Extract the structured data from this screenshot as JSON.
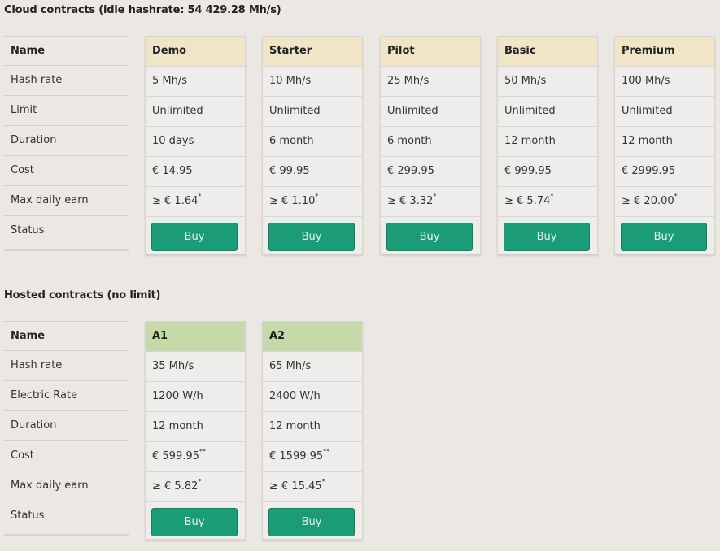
{
  "cloud": {
    "title": "Cloud contracts (idle hashrate: 54 429.28 Mh/s)",
    "labels": [
      "Name",
      "Hash rate",
      "Limit",
      "Duration",
      "Cost",
      "Max daily earn",
      "Status"
    ],
    "plans": [
      {
        "name": "Demo",
        "hash_rate": "5 Mh/s",
        "limit": "Unlimited",
        "duration": "10 days",
        "cost": "€ 14.95",
        "earn": "≥ € 1.64",
        "earn_mark": "*",
        "button": "Buy"
      },
      {
        "name": "Starter",
        "hash_rate": "10 Mh/s",
        "limit": "Unlimited",
        "duration": "6 month",
        "cost": "€ 99.95",
        "earn": "≥ € 1.10",
        "earn_mark": "*",
        "button": "Buy"
      },
      {
        "name": "Pilot",
        "hash_rate": "25 Mh/s",
        "limit": "Unlimited",
        "duration": "6 month",
        "cost": "€ 299.95",
        "earn": "≥ € 3.32",
        "earn_mark": "*",
        "button": "Buy"
      },
      {
        "name": "Basic",
        "hash_rate": "50 Mh/s",
        "limit": "Unlimited",
        "duration": "12 month",
        "cost": "€ 999.95",
        "earn": "≥ € 5.74",
        "earn_mark": "*",
        "button": "Buy"
      },
      {
        "name": "Premium",
        "hash_rate": "100 Mh/s",
        "limit": "Unlimited",
        "duration": "12 month",
        "cost": "€ 2999.95",
        "earn": "≥ € 20.00",
        "earn_mark": "*",
        "button": "Buy"
      }
    ]
  },
  "hosted": {
    "title": "Hosted contracts (no limit)",
    "labels": [
      "Name",
      "Hash rate",
      "Electric Rate",
      "Duration",
      "Cost",
      "Max daily earn",
      "Status"
    ],
    "plans": [
      {
        "name": "A1",
        "hash_rate": "35 Mh/s",
        "electric_rate": "1200 W/h",
        "duration": "12 month",
        "cost": "€ 599.95",
        "cost_mark": "**",
        "earn": "≥ € 5.82",
        "earn_mark": "*",
        "button": "Buy"
      },
      {
        "name": "A2",
        "hash_rate": "65 Mh/s",
        "electric_rate": "2400 W/h",
        "duration": "12 month",
        "cost": "€ 1599.95",
        "cost_mark": "**",
        "earn": "≥ € 15.45",
        "earn_mark": "*",
        "button": "Buy"
      }
    ]
  },
  "colors": {
    "background": "#ebe8e4",
    "cloud_header": "#f0e5c7",
    "hosted_header": "#c6d9a9",
    "buy_button": "#1a9c76"
  }
}
